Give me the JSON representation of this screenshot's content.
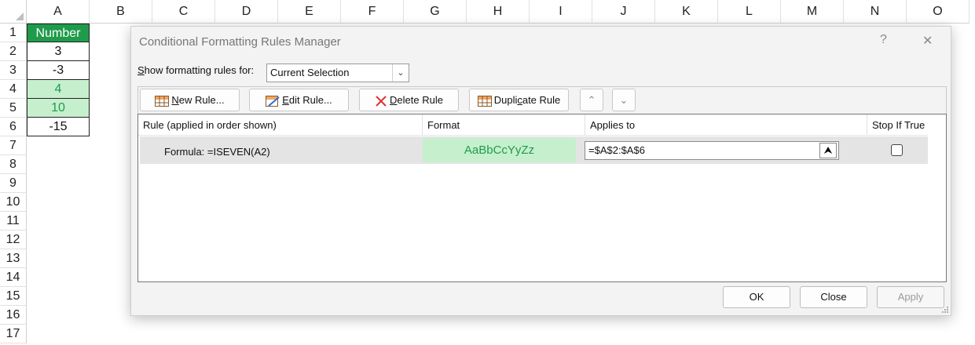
{
  "sheet": {
    "columns": [
      "A",
      "B",
      "C",
      "D",
      "E",
      "F",
      "G",
      "H",
      "I",
      "J",
      "K",
      "L",
      "M",
      "N",
      "O"
    ],
    "rows": [
      "1",
      "2",
      "3",
      "4",
      "5",
      "6",
      "7",
      "8",
      "9",
      "10",
      "11",
      "12",
      "13",
      "14",
      "15",
      "16",
      "17"
    ],
    "cells": [
      "Number",
      "3",
      "-3",
      "4",
      "10",
      "-15"
    ]
  },
  "dialog": {
    "title": "Conditional Formatting Rules Manager",
    "help_glyph": "?",
    "close_glyph": "✕",
    "show_label_prefix": "S",
    "show_label_rest": "how formatting rules for:",
    "show_value": "Current Selection",
    "buttons": {
      "new_rule_u": "N",
      "new_rule_rest": "ew Rule...",
      "edit_rule_u": "E",
      "edit_rule_rest": "dit Rule...",
      "delete_rule_u": "D",
      "delete_rule_rest": "elete Rule",
      "duplicate_pre": "Dupli",
      "duplicate_u": "c",
      "duplicate_rest": "ate Rule"
    },
    "columns": {
      "rule": "Rule (applied in order shown)",
      "format": "Format",
      "applies": "Applies to",
      "stop": "Stop If True"
    },
    "rule": {
      "formula": "Formula: =ISEVEN(A2)",
      "preview": "AaBbCcYyZz",
      "applies_to": "=$A$2:$A$6",
      "stop_if_true": false
    },
    "footer": {
      "ok": "OK",
      "close": "Close",
      "apply": "Apply"
    }
  },
  "colors": {
    "header_green": "#1f9b4b",
    "highlight_fill": "#c6efce"
  }
}
